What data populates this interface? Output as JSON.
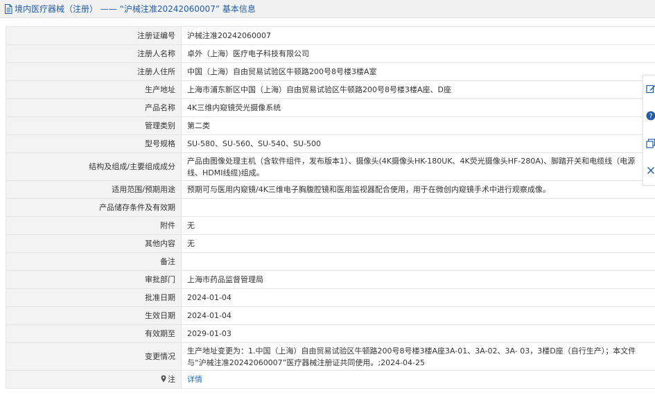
{
  "header": {
    "title": "境内医疗器械（注册） —— “沪械注准20242060007” 基本信息"
  },
  "rows": [
    {
      "label": "注册证编号",
      "value": "沪械注准20242060007"
    },
    {
      "label": "注册人名称",
      "value": "卓外（上海）医疗电子科技有限公司"
    },
    {
      "label": "注册人住所",
      "value": "中国（上海）自由贸易试验区牛顿路200号8号楼3楼A室"
    },
    {
      "label": "生产地址",
      "value": "上海市浦东新区中国（上海）自由贸易试验区牛顿路200号8号楼3楼A座、D座"
    },
    {
      "label": "产品名称",
      "value": "4K三维内窥镜荧光摄像系统"
    },
    {
      "label": "管理类别",
      "value": "第二类"
    },
    {
      "label": "型号规格",
      "value": "SU-580、SU-560、SU-540、SU-500"
    },
    {
      "label": "结构及组成/主要组成成分",
      "value": "产品由图像处理主机（含软件组件，发布版本1）、摄像头(4K摄像头HK-180UK、4K荧光摄像头HF-280A)、脚踏开关和电缆线（电源线、HDMI线缆)组成。"
    },
    {
      "label": "适用范围/预期用途",
      "value": "预期可与医用内窥镜/4K三维电子胸腹腔镜和医用监视器配合使用，用于在微创内窥镜手术中进行观察成像。"
    },
    {
      "label": "产品储存条件及有效期",
      "value": ""
    },
    {
      "label": "附件",
      "value": "无"
    },
    {
      "label": "其他内容",
      "value": "无"
    },
    {
      "label": "备注",
      "value": ""
    },
    {
      "label": "审批部门",
      "value": "上海市药品监督管理局"
    },
    {
      "label": "批准日期",
      "value": "2024-01-04"
    },
    {
      "label": "生效日期",
      "value": "2024-01-04"
    },
    {
      "label": "有效期至",
      "value": "2029-01-03"
    },
    {
      "label": "变更情况",
      "value": "生产地址变更为：1.中国（上海）自由贸易试验区牛顿路200号8号楼3楼A座3A-01、3A-02、3A- 03，3楼D座（自行生产）；本文件与“沪械注准20242060007”医疗器械注册证共同使用。;2024-04-25"
    }
  ],
  "note_row": {
    "label": "注",
    "link": "详情"
  },
  "colors": {
    "header_text": "#1e5ca8",
    "link": "#1e6ad0",
    "label_bg": "#f3f3f3"
  },
  "icons": [
    "document-icon",
    "pin-icon",
    "edit-icon",
    "help-icon",
    "share-icon",
    "close-icon"
  ]
}
